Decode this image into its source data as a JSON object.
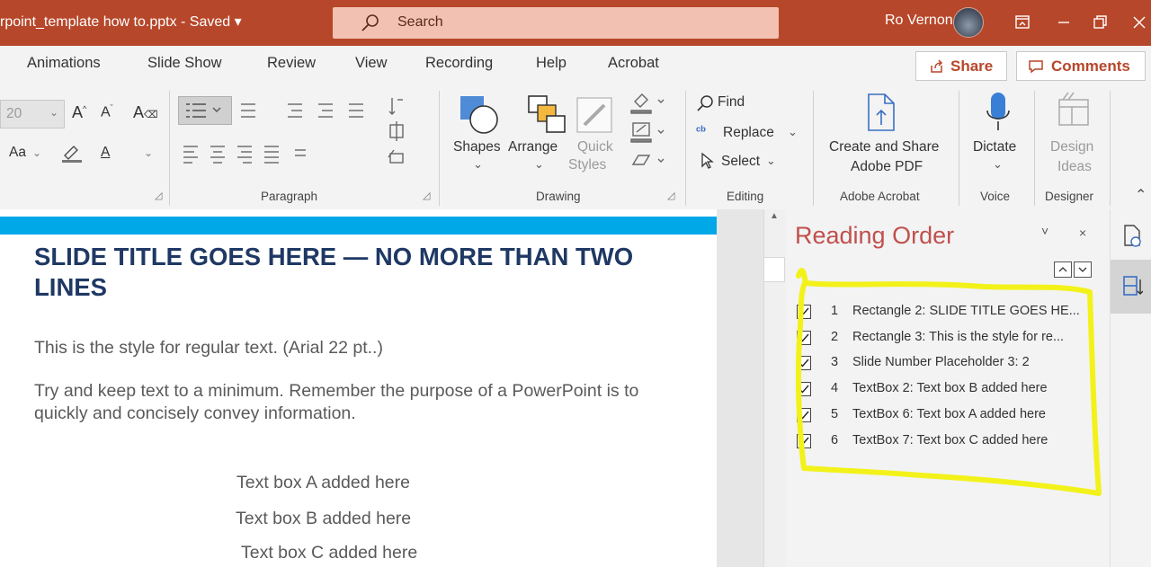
{
  "titlebar": {
    "doc_title": "rpoint_template how to.pptx  -  Saved  ▾",
    "search_label": "Search",
    "user_name": "Ro Vernon",
    "color": "#b7472a"
  },
  "tabs": [
    {
      "label": "Animations"
    },
    {
      "label": "Slide Show"
    },
    {
      "label": "Review"
    },
    {
      "label": "View"
    },
    {
      "label": "Recording"
    },
    {
      "label": "Help"
    },
    {
      "label": "Acrobat"
    }
  ],
  "share_label": "Share",
  "comments_label": "Comments",
  "ribbon": {
    "font_size": "20",
    "font_case": "Aa",
    "groups": {
      "paragraph": "Paragraph",
      "drawing": "Drawing",
      "editing": "Editing",
      "adobe": "Adobe Acrobat",
      "voice": "Voice",
      "designer": "Designer"
    },
    "shapes": "Shapes",
    "arrange": "Arrange",
    "quick": "Quick",
    "styles": "Styles",
    "find": "Find",
    "replace": "Replace",
    "select": "Select",
    "create_share_1": "Create and Share",
    "create_share_2": "Adobe PDF",
    "dictate": "Dictate",
    "design": "Design",
    "ideas": "Ideas"
  },
  "slide": {
    "title": "SLIDE TITLE GOES HERE — NO MORE THAN TWO LINES",
    "body1": "This is the style for regular text. (Arial 22 pt..)",
    "body2": "Try and keep text to a minimum. Remember the purpose of a PowerPoint is to quickly and concisely convey information.",
    "tb_a": "Text box A added here",
    "tb_b": "Text box B added here",
    "tb_c": "Text box C added here",
    "accent": "#00a8e8"
  },
  "pane": {
    "title": "Reading Order",
    "highlight": "#f2f21a",
    "rows": [
      {
        "num": "1",
        "text": "Rectangle 2: SLIDE TITLE GOES HE..."
      },
      {
        "num": "2",
        "text": "Rectangle 3: This is the style for re..."
      },
      {
        "num": "3",
        "text": "Slide Number Placeholder 3: 2"
      },
      {
        "num": "4",
        "text": "TextBox 2:   Text box B added here"
      },
      {
        "num": "5",
        "text": "TextBox 6: Text box A added here"
      },
      {
        "num": "6",
        "text": "TextBox 7: Text box C added here"
      }
    ]
  }
}
